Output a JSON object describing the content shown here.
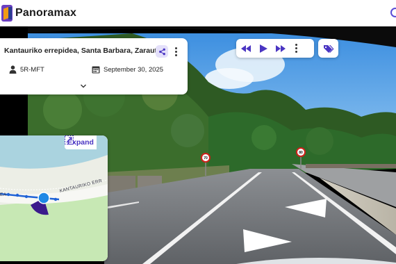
{
  "app": {
    "title": "Panoramax"
  },
  "location_card": {
    "title": "Kantauriko errepidea, Santa Barbara, Zarautz",
    "author": "5R-MFT",
    "date": "September 30, 2025"
  },
  "minimap": {
    "expand_label": "Expand",
    "street_label_left": "EA",
    "street_label_right": "KANTAURIKO ERR"
  },
  "scene": {
    "speed_limit_left": "70",
    "speed_limit_right": "80"
  },
  "icons": {
    "logo": "panoramax-logo",
    "share": "share-icon",
    "more": "more-vertical-icon",
    "author": "person-icon",
    "date": "calendar-icon",
    "expand_card": "chevron-down-icon",
    "prev": "fast-rewind-icon",
    "play": "play-icon",
    "next": "fast-forward-icon",
    "tags": "tag-icon",
    "expand_map": "expand-icon"
  },
  "colors": {
    "accent": "#5a3fd1",
    "accent_light": "#e4e0fa"
  }
}
